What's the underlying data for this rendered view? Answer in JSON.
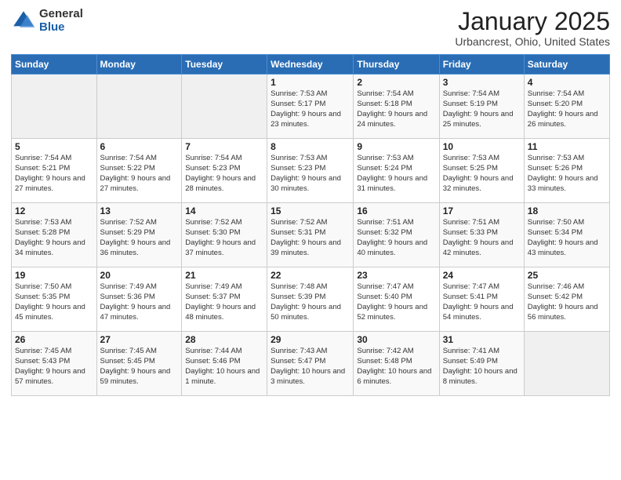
{
  "header": {
    "logo_general": "General",
    "logo_blue": "Blue",
    "month_title": "January 2025",
    "location": "Urbancrest, Ohio, United States"
  },
  "days_of_week": [
    "Sunday",
    "Monday",
    "Tuesday",
    "Wednesday",
    "Thursday",
    "Friday",
    "Saturday"
  ],
  "weeks": [
    [
      {
        "day": "",
        "info": ""
      },
      {
        "day": "",
        "info": ""
      },
      {
        "day": "",
        "info": ""
      },
      {
        "day": "1",
        "info": "Sunrise: 7:53 AM\nSunset: 5:17 PM\nDaylight: 9 hours\nand 23 minutes."
      },
      {
        "day": "2",
        "info": "Sunrise: 7:54 AM\nSunset: 5:18 PM\nDaylight: 9 hours\nand 24 minutes."
      },
      {
        "day": "3",
        "info": "Sunrise: 7:54 AM\nSunset: 5:19 PM\nDaylight: 9 hours\nand 25 minutes."
      },
      {
        "day": "4",
        "info": "Sunrise: 7:54 AM\nSunset: 5:20 PM\nDaylight: 9 hours\nand 26 minutes."
      }
    ],
    [
      {
        "day": "5",
        "info": "Sunrise: 7:54 AM\nSunset: 5:21 PM\nDaylight: 9 hours\nand 27 minutes."
      },
      {
        "day": "6",
        "info": "Sunrise: 7:54 AM\nSunset: 5:22 PM\nDaylight: 9 hours\nand 27 minutes."
      },
      {
        "day": "7",
        "info": "Sunrise: 7:54 AM\nSunset: 5:23 PM\nDaylight: 9 hours\nand 28 minutes."
      },
      {
        "day": "8",
        "info": "Sunrise: 7:53 AM\nSunset: 5:23 PM\nDaylight: 9 hours\nand 30 minutes."
      },
      {
        "day": "9",
        "info": "Sunrise: 7:53 AM\nSunset: 5:24 PM\nDaylight: 9 hours\nand 31 minutes."
      },
      {
        "day": "10",
        "info": "Sunrise: 7:53 AM\nSunset: 5:25 PM\nDaylight: 9 hours\nand 32 minutes."
      },
      {
        "day": "11",
        "info": "Sunrise: 7:53 AM\nSunset: 5:26 PM\nDaylight: 9 hours\nand 33 minutes."
      }
    ],
    [
      {
        "day": "12",
        "info": "Sunrise: 7:53 AM\nSunset: 5:28 PM\nDaylight: 9 hours\nand 34 minutes."
      },
      {
        "day": "13",
        "info": "Sunrise: 7:52 AM\nSunset: 5:29 PM\nDaylight: 9 hours\nand 36 minutes."
      },
      {
        "day": "14",
        "info": "Sunrise: 7:52 AM\nSunset: 5:30 PM\nDaylight: 9 hours\nand 37 minutes."
      },
      {
        "day": "15",
        "info": "Sunrise: 7:52 AM\nSunset: 5:31 PM\nDaylight: 9 hours\nand 39 minutes."
      },
      {
        "day": "16",
        "info": "Sunrise: 7:51 AM\nSunset: 5:32 PM\nDaylight: 9 hours\nand 40 minutes."
      },
      {
        "day": "17",
        "info": "Sunrise: 7:51 AM\nSunset: 5:33 PM\nDaylight: 9 hours\nand 42 minutes."
      },
      {
        "day": "18",
        "info": "Sunrise: 7:50 AM\nSunset: 5:34 PM\nDaylight: 9 hours\nand 43 minutes."
      }
    ],
    [
      {
        "day": "19",
        "info": "Sunrise: 7:50 AM\nSunset: 5:35 PM\nDaylight: 9 hours\nand 45 minutes."
      },
      {
        "day": "20",
        "info": "Sunrise: 7:49 AM\nSunset: 5:36 PM\nDaylight: 9 hours\nand 47 minutes."
      },
      {
        "day": "21",
        "info": "Sunrise: 7:49 AM\nSunset: 5:37 PM\nDaylight: 9 hours\nand 48 minutes."
      },
      {
        "day": "22",
        "info": "Sunrise: 7:48 AM\nSunset: 5:39 PM\nDaylight: 9 hours\nand 50 minutes."
      },
      {
        "day": "23",
        "info": "Sunrise: 7:47 AM\nSunset: 5:40 PM\nDaylight: 9 hours\nand 52 minutes."
      },
      {
        "day": "24",
        "info": "Sunrise: 7:47 AM\nSunset: 5:41 PM\nDaylight: 9 hours\nand 54 minutes."
      },
      {
        "day": "25",
        "info": "Sunrise: 7:46 AM\nSunset: 5:42 PM\nDaylight: 9 hours\nand 56 minutes."
      }
    ],
    [
      {
        "day": "26",
        "info": "Sunrise: 7:45 AM\nSunset: 5:43 PM\nDaylight: 9 hours\nand 57 minutes."
      },
      {
        "day": "27",
        "info": "Sunrise: 7:45 AM\nSunset: 5:45 PM\nDaylight: 9 hours\nand 59 minutes."
      },
      {
        "day": "28",
        "info": "Sunrise: 7:44 AM\nSunset: 5:46 PM\nDaylight: 10 hours\nand 1 minute."
      },
      {
        "day": "29",
        "info": "Sunrise: 7:43 AM\nSunset: 5:47 PM\nDaylight: 10 hours\nand 3 minutes."
      },
      {
        "day": "30",
        "info": "Sunrise: 7:42 AM\nSunset: 5:48 PM\nDaylight: 10 hours\nand 6 minutes."
      },
      {
        "day": "31",
        "info": "Sunrise: 7:41 AM\nSunset: 5:49 PM\nDaylight: 10 hours\nand 8 minutes."
      },
      {
        "day": "",
        "info": ""
      }
    ]
  ]
}
